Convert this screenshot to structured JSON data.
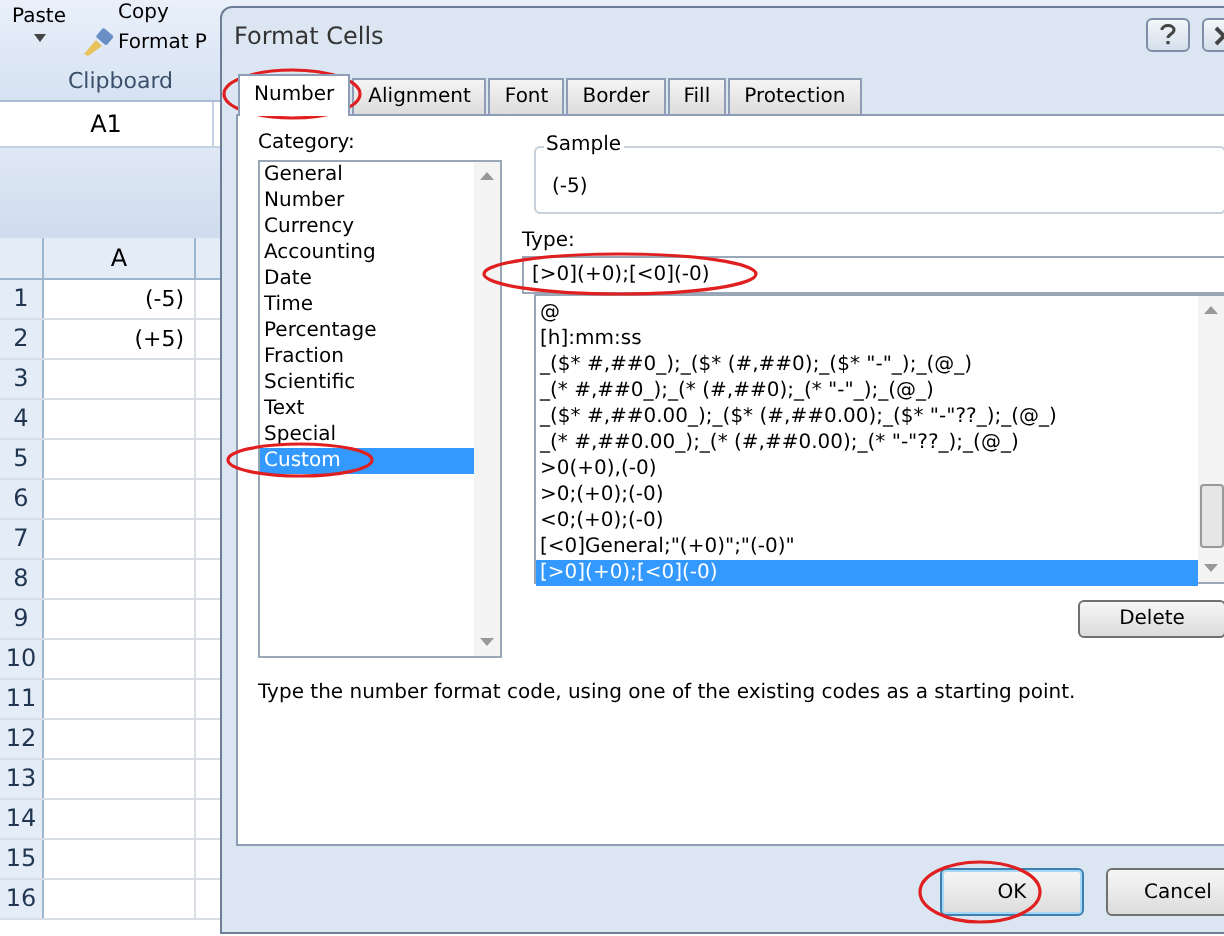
{
  "ribbon": {
    "paste_label": "Paste",
    "copy_label": "Copy",
    "format_painter_label": "Format P",
    "group_label": "Clipboard"
  },
  "name_box": {
    "value": "A1"
  },
  "sheet": {
    "columns": [
      "A"
    ],
    "rows": [
      {
        "number": "1",
        "value": "(-5)"
      },
      {
        "number": "2",
        "value": "(+5)"
      },
      {
        "number": "3"
      },
      {
        "number": "4"
      },
      {
        "number": "5"
      },
      {
        "number": "6"
      },
      {
        "number": "7"
      },
      {
        "number": "8"
      },
      {
        "number": "9"
      },
      {
        "number": "10"
      },
      {
        "number": "11"
      },
      {
        "number": "12"
      },
      {
        "number": "13"
      },
      {
        "number": "14"
      },
      {
        "number": "15"
      },
      {
        "number": "16"
      }
    ]
  },
  "dialog": {
    "title": "Format Cells",
    "tabs": [
      {
        "label": "Number",
        "selected": true
      },
      {
        "label": "Alignment",
        "selected": false
      },
      {
        "label": "Font",
        "selected": false
      },
      {
        "label": "Border",
        "selected": false
      },
      {
        "label": "Fill",
        "selected": false
      },
      {
        "label": "Protection",
        "selected": false
      }
    ],
    "category_label": "Category:",
    "categories": [
      {
        "label": "General",
        "selected": false
      },
      {
        "label": "Number",
        "selected": false
      },
      {
        "label": "Currency",
        "selected": false
      },
      {
        "label": "Accounting",
        "selected": false
      },
      {
        "label": "Date",
        "selected": false
      },
      {
        "label": "Time",
        "selected": false
      },
      {
        "label": "Percentage",
        "selected": false
      },
      {
        "label": "Fraction",
        "selected": false
      },
      {
        "label": "Scientific",
        "selected": false
      },
      {
        "label": "Text",
        "selected": false
      },
      {
        "label": "Special",
        "selected": false
      },
      {
        "label": "Custom",
        "selected": true
      }
    ],
    "sample_label": "Sample",
    "sample_value": "(-5)",
    "type_label": "Type:",
    "type_value": "[>0](+0);[<0](-0)",
    "formats": [
      {
        "label": "@",
        "selected": false
      },
      {
        "label": "[h]:mm:ss",
        "selected": false
      },
      {
        "label": "_($* #,##0_);_($* (#,##0);_($* \"-\"_);_(@_)",
        "selected": false
      },
      {
        "label": "_(* #,##0_);_(* (#,##0);_(* \"-\"_);_(@_)",
        "selected": false
      },
      {
        "label": "_($* #,##0.00_);_($* (#,##0.00);_($* \"-\"??_);_(@_)",
        "selected": false
      },
      {
        "label": "_(* #,##0.00_);_(* (#,##0.00);_(* \"-\"??_);_(@_)",
        "selected": false
      },
      {
        "label": ">0(+0),(-0)",
        "selected": false
      },
      {
        "label": ">0;(+0);(-0)",
        "selected": false
      },
      {
        "label": "<0;(+0);(-0)",
        "selected": false
      },
      {
        "label": "[<0]General;\"(+0)\";\"(-0)\"",
        "selected": false
      },
      {
        "label": "[>0](+0);[<0](-0)",
        "selected": true
      }
    ],
    "delete_button": "Delete",
    "hint": "Type the number format code, using one of the existing codes as a starting point.",
    "buttons": [
      {
        "label": "OK",
        "default": true
      },
      {
        "label": "Cancel",
        "default": false
      }
    ]
  }
}
